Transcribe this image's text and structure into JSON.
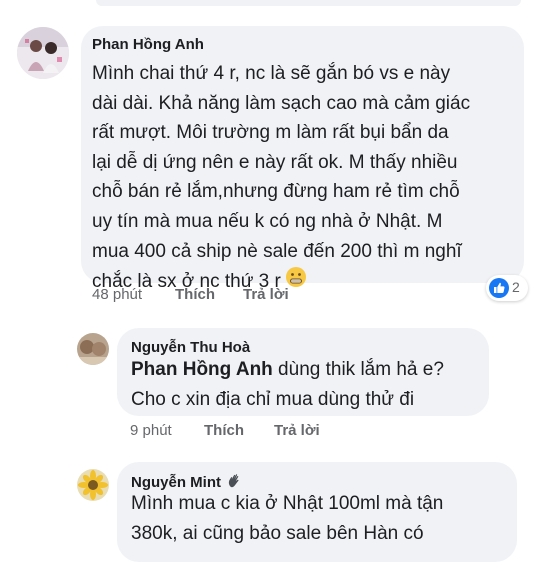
{
  "comments": [
    {
      "author": "Phan Hồng Anh",
      "lines": [
        "Mình chai thứ 4 r, nc là sẽ gắn bó vs e này",
        "dài dài. Khả năng làm sạch cao mà cảm giác",
        "rất mượt. Môi trường m làm rất bụi bẩn da",
        "lại dễ dị ứng nên e này rất ok. M thấy nhiều",
        "chỗ bán rẻ lắm,nhưng đừng ham rẻ tìm chỗ",
        "uy tín mà mua nếu k có ng nhà ở Nhật. M",
        "mua 400 cả ship nè sale đến 200 thì m nghĩ",
        "chắc là sx ở nc thứ 3 r"
      ],
      "emoji": "grimacing-face-emoji",
      "time": "48 phút",
      "like_label": "Thích",
      "reply_label": "Trả lời",
      "reaction_count": "2"
    },
    {
      "author": "Nguyễn Thu Hoà",
      "mention": "Phan Hồng Anh",
      "line1_rest": " dùng thik lắm hả e?",
      "line2": "Cho c xin địa chỉ mua dùng thử đi",
      "time": "9 phút",
      "like_label": "Thích",
      "reply_label": "Trả lời"
    },
    {
      "author": "Nguyễn Mint",
      "author_icon": "waving-hand-icon",
      "lines": [
        "Mình mua c kia ở Nhật 100ml mà tận",
        "380k, ai cũng bảo sale bên Hàn có"
      ]
    }
  ],
  "colors": {
    "bubble": "#f0f2f5",
    "text": "#1c1e21",
    "meta": "#65676b",
    "like_blue": "#1877f2"
  }
}
